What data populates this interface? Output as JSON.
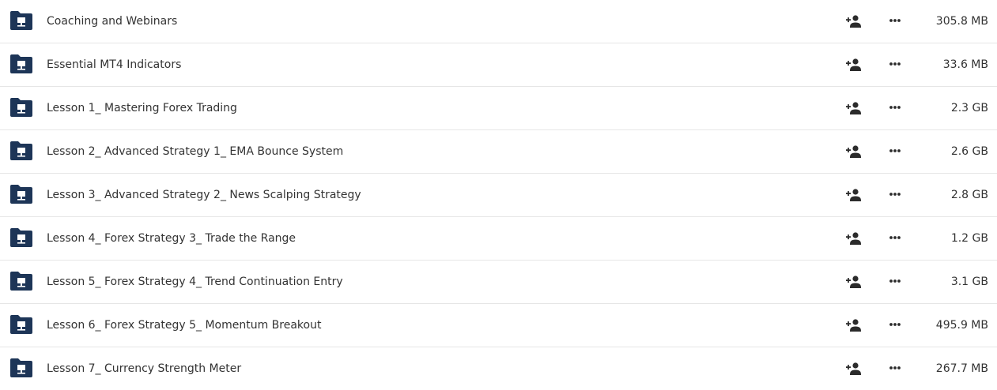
{
  "colors": {
    "folder": "#1d3557",
    "icon": "#2b2b2b",
    "divider": "#e6e6e6"
  },
  "icons": {
    "folder": "shared-folder-icon",
    "share": "person-add-icon",
    "more": "more-horizontal-icon"
  },
  "files": [
    {
      "name": "Coaching and Webinars",
      "size": "305.8 MB"
    },
    {
      "name": "Essential MT4 Indicators",
      "size": "33.6 MB"
    },
    {
      "name": "Lesson 1_ Mastering Forex Trading",
      "size": "2.3 GB"
    },
    {
      "name": "Lesson 2_ Advanced Strategy 1_ EMA Bounce System",
      "size": "2.6 GB"
    },
    {
      "name": "Lesson 3_ Advanced Strategy 2_ News Scalping Strategy",
      "size": "2.8 GB"
    },
    {
      "name": "Lesson 4_ Forex Strategy 3_ Trade the Range",
      "size": "1.2 GB"
    },
    {
      "name": "Lesson 5_ Forex Strategy 4_ Trend Continuation Entry",
      "size": "3.1 GB"
    },
    {
      "name": "Lesson 6_ Forex Strategy 5_ Momentum Breakout",
      "size": "495.9 MB"
    },
    {
      "name": "Lesson 7_ Currency Strength Meter",
      "size": "267.7 MB"
    }
  ]
}
